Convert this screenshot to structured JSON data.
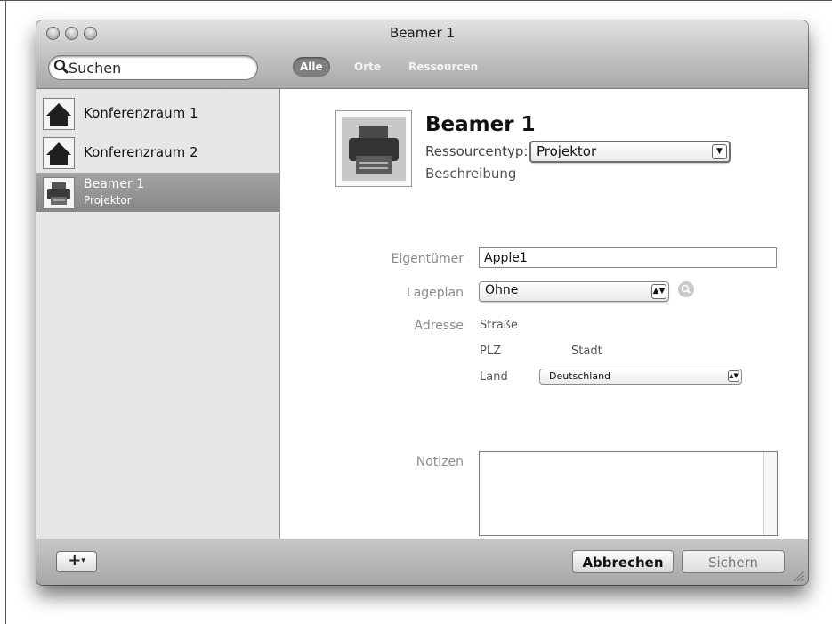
{
  "window": {
    "title": "Beamer 1"
  },
  "toolbar": {
    "search_placeholder": "Suchen",
    "filters": [
      "Alle",
      "Orte",
      "Ressourcen"
    ],
    "active_filter": "Alle"
  },
  "sidebar": {
    "items": [
      {
        "label": "Konferenzraum 1",
        "icon": "house-icon"
      },
      {
        "label": "Konferenzraum 2",
        "icon": "house-icon"
      },
      {
        "label": "Beamer 1",
        "sublabel": "Projektor",
        "icon": "printer-icon",
        "selected": true
      }
    ]
  },
  "detail": {
    "title": "Beamer 1",
    "resource_type_label": "Ressourcentyp:",
    "resource_type_value": "Projektor",
    "description_label": "Beschreibung",
    "owner_label": "Eigentümer",
    "owner_value": "Apple1",
    "floorplan_label": "Lageplan",
    "floorplan_value": "Ohne",
    "address_label": "Adresse",
    "street_label": "Straße",
    "zip_label": "PLZ",
    "city_label": "Stadt",
    "country_label": "Land",
    "country_value": "Deutschland",
    "notes_label": "Notizen",
    "notes_value": ""
  },
  "bottombar": {
    "add_label": "+",
    "cancel_label": "Abbrechen",
    "save_label": "Sichern"
  }
}
